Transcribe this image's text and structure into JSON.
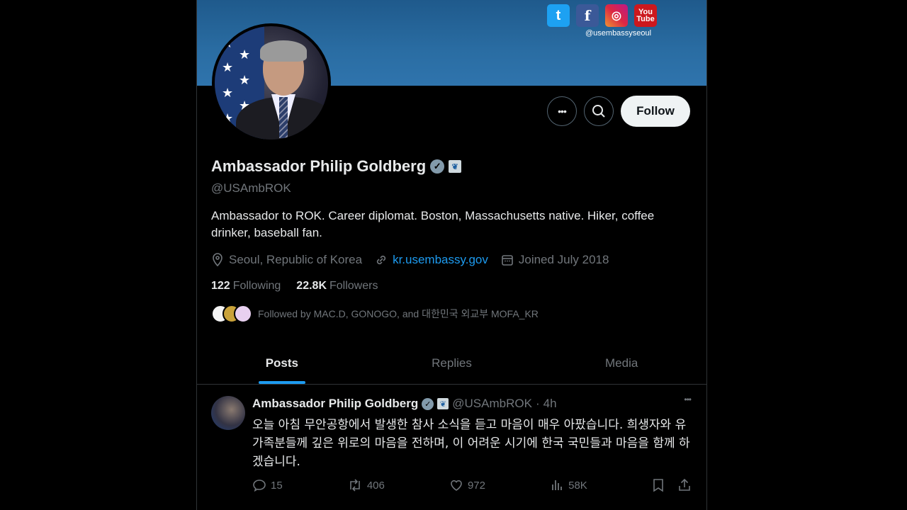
{
  "banner": {
    "social": [
      "t",
      "f",
      "◎",
      "You\nTube"
    ],
    "handle": "@usembassyseoul"
  },
  "actions": {
    "more": "•••",
    "follow_label": "Follow"
  },
  "profile": {
    "name": "Ambassador Philip Goldberg",
    "handle": "@USAmbROK",
    "bio": "Ambassador to ROK. Career diplomat. Boston, Massachusetts native. Hiker, coffee drinker, baseball fan.",
    "location": "Seoul, Republic of Korea",
    "website": "kr.usembassy.gov",
    "joined": "Joined July 2018",
    "following_count": "122",
    "following_label": "Following",
    "followers_count": "22.8K",
    "followers_label": "Followers",
    "followed_by": "Followed by MAC.D, GONOGO, and 대한민국 외교부 MOFA_KR"
  },
  "tabs": [
    {
      "label": "Posts"
    },
    {
      "label": "Replies"
    },
    {
      "label": "Media"
    }
  ],
  "post": {
    "name": "Ambassador Philip Goldberg",
    "handle": "@USAmbROK",
    "sep": "·",
    "time": "4h",
    "more": "•••",
    "text": "오늘 아침 무안공항에서 발생한 참사 소식을 듣고 마음이 매우 아팠습니다. 희생자와 유가족분들께 깊은 위로의 마음을 전하며, 이 어려운 시기에 한국 국민들과 마음을 함께 하겠습니다.",
    "replies": "15",
    "reposts": "406",
    "likes": "972",
    "views": "58K"
  },
  "colors": {
    "accent": "#1d9bf0",
    "muted": "#71767b",
    "banner": "#2a6da3"
  }
}
